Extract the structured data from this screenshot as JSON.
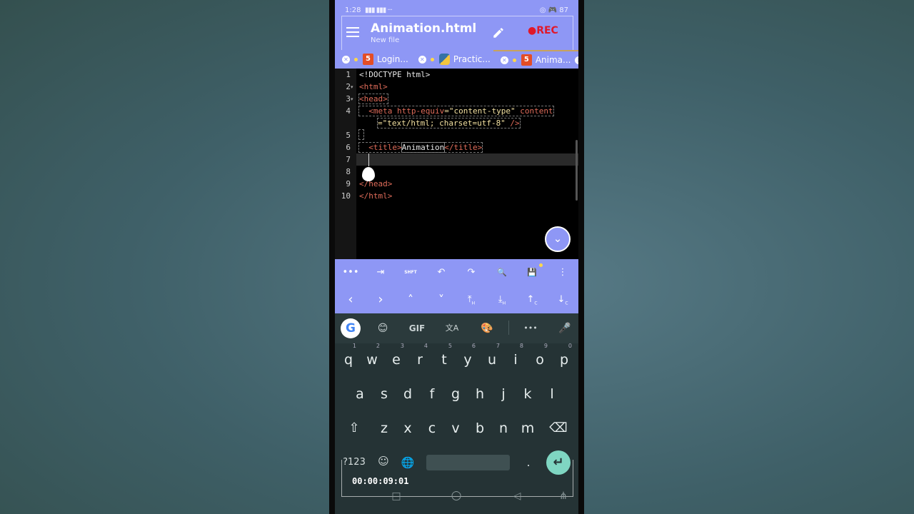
{
  "status": {
    "time": "1:28",
    "signal": "▮▮▮ ▮▮▮ ···",
    "right": "◎ 🎮 87"
  },
  "appbar": {
    "title": "Animation.html",
    "subtitle": "New file",
    "rec": "●REC"
  },
  "tabs": [
    {
      "label": "Login...",
      "icon": "html5-icon"
    },
    {
      "label": "Practic...",
      "icon": "python-icon"
    },
    {
      "label": "Anima...",
      "icon": "html5-icon"
    }
  ],
  "editor": {
    "line_numbers": [
      "1",
      "2",
      "3",
      "4",
      "",
      "5",
      "6",
      "7",
      "8",
      "9",
      "10"
    ],
    "lines": {
      "l1": "<!DOCTYPE html>",
      "l2": "<html>",
      "l3": "<head>",
      "l4a": "<meta",
      "l4b": " http-equiv",
      "l4c": "=\"content-type\"",
      "l4d": " content",
      "l4e": "=\"text/html; charset=utf-8\"",
      "l4f": " />",
      "l6a": "<title>",
      "l6b": "Animation",
      "l6c": "</title>",
      "l9": "</head>",
      "l10": "</html>"
    }
  },
  "toolbar": {
    "row1": [
      "•••",
      "⇥",
      "SHFT",
      "↶",
      "↷",
      "🔍",
      "💾",
      "⋮"
    ],
    "row2": [
      "‹",
      "›",
      "˄",
      "˅",
      "⤒",
      "⤓",
      "↑",
      "↓"
    ],
    "row2_small": [
      "",
      "",
      "",
      "",
      "H",
      "H",
      "C",
      "C"
    ]
  },
  "keyboard": {
    "suggest": [
      "😊",
      "GIF",
      "文A",
      "🎨",
      "•••",
      "🎤"
    ],
    "google": "G",
    "row1": [
      {
        "k": "q",
        "n": "1"
      },
      {
        "k": "w",
        "n": "2"
      },
      {
        "k": "e",
        "n": "3"
      },
      {
        "k": "r",
        "n": "4"
      },
      {
        "k": "t",
        "n": "5"
      },
      {
        "k": "y",
        "n": "6"
      },
      {
        "k": "u",
        "n": "7"
      },
      {
        "k": "i",
        "n": "8"
      },
      {
        "k": "o",
        "n": "9"
      },
      {
        "k": "p",
        "n": "0"
      }
    ],
    "row2": [
      "a",
      "s",
      "d",
      "f",
      "g",
      "h",
      "j",
      "k",
      "l"
    ],
    "row3": [
      "z",
      "x",
      "c",
      "v",
      "b",
      "n",
      "m"
    ],
    "shift": "⇧",
    "backspace": "⌫",
    "symbols": "?123",
    "emoji": "☺",
    "globe": "🌐",
    "period": ".",
    "enter": "↵"
  },
  "timer": "00:00:09:01",
  "nav": [
    "□",
    "○",
    "◁",
    "⋔"
  ]
}
